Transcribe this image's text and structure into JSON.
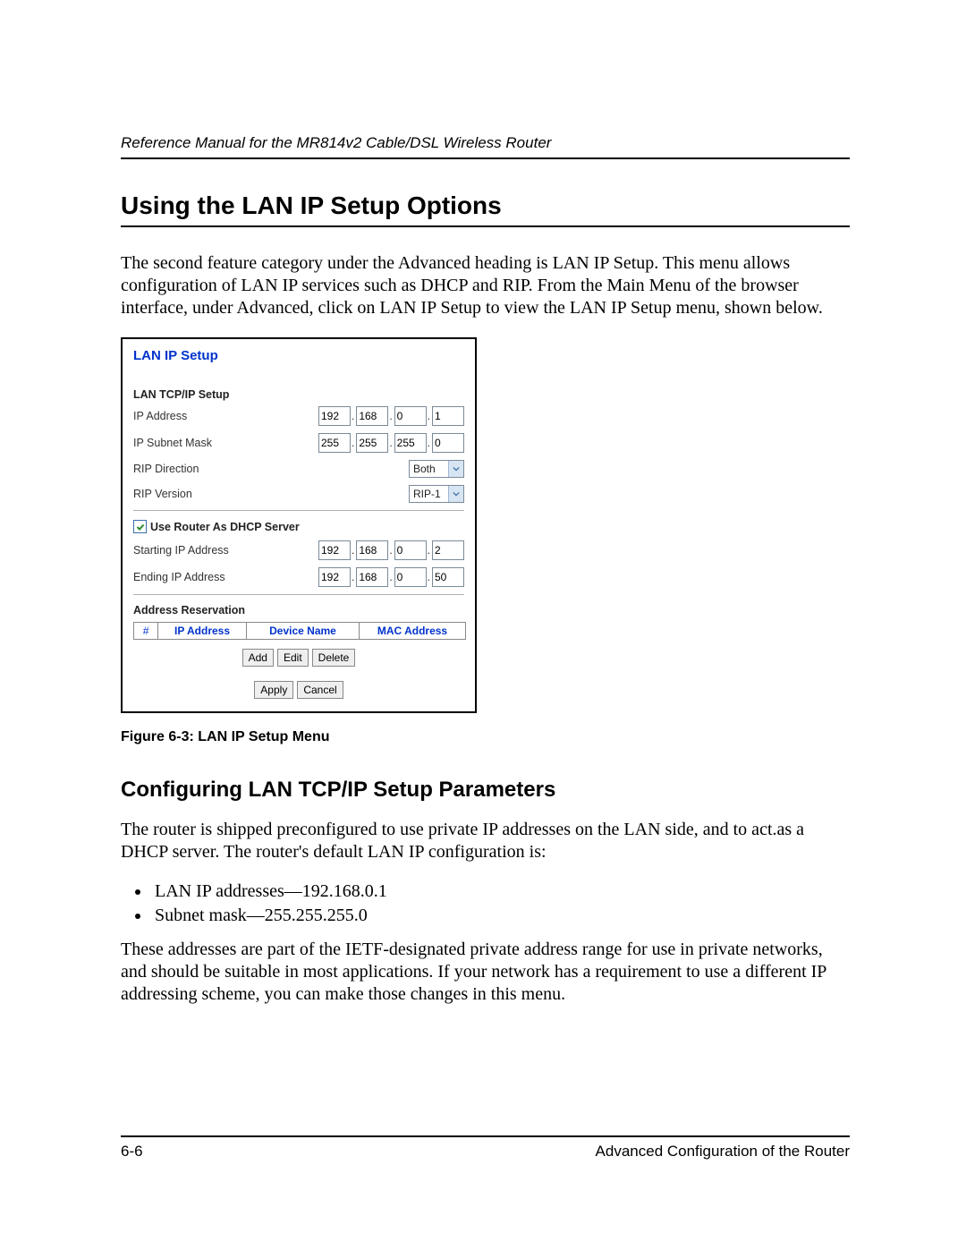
{
  "header": {
    "running_title": "Reference Manual for the MR814v2 Cable/DSL Wireless Router"
  },
  "section": {
    "title": "Using the LAN IP Setup Options",
    "para1": "The second feature category under the Advanced heading is LAN IP Setup. This menu allows configuration of LAN IP services such as DHCP and RIP. From the Main Menu of the browser interface, under Advanced, click on LAN IP Setup to view the LAN IP Setup menu, shown below."
  },
  "screenshot": {
    "title": "LAN IP Setup",
    "tcpip_heading": "LAN TCP/IP Setup",
    "ip_address_label": "IP Address",
    "ip_address": [
      "192",
      "168",
      "0",
      "1"
    ],
    "subnet_label": "IP Subnet Mask",
    "subnet": [
      "255",
      "255",
      "255",
      "0"
    ],
    "rip_dir_label": "RIP Direction",
    "rip_dir_value": "Both",
    "rip_ver_label": "RIP Version",
    "rip_ver_value": "RIP-1",
    "dhcp_checkbox_label": "Use Router As DHCP Server",
    "start_ip_label": "Starting IP Address",
    "start_ip": [
      "192",
      "168",
      "0",
      "2"
    ],
    "end_ip_label": "Ending IP Address",
    "end_ip": [
      "192",
      "168",
      "0",
      "50"
    ],
    "reservation_heading": "Address Reservation",
    "table": {
      "hash": "#",
      "ip": "IP Address",
      "device": "Device Name",
      "mac": "MAC Address"
    },
    "buttons": {
      "add": "Add",
      "edit": "Edit",
      "delete": "Delete",
      "apply": "Apply",
      "cancel": "Cancel"
    }
  },
  "figure_caption": "Figure 6-3:  LAN IP Setup Menu",
  "subsection": {
    "title": "Configuring LAN TCP/IP Setup Parameters",
    "para1": "The router is shipped preconfigured to use private IP addresses on the LAN side, and to act.as a DHCP server. The router's default LAN IP configuration is:",
    "bullet1": "LAN IP addresses—192.168.0.1",
    "bullet2": "Subnet mask—255.255.255.0",
    "para2": "These addresses are part of the IETF-designated private address range for use in private networks, and should be suitable in most applications. If your network has a requirement to use a different IP addressing scheme, you can make those changes in this menu."
  },
  "footer": {
    "page": "6-6",
    "chapter": "Advanced Configuration of the Router"
  }
}
